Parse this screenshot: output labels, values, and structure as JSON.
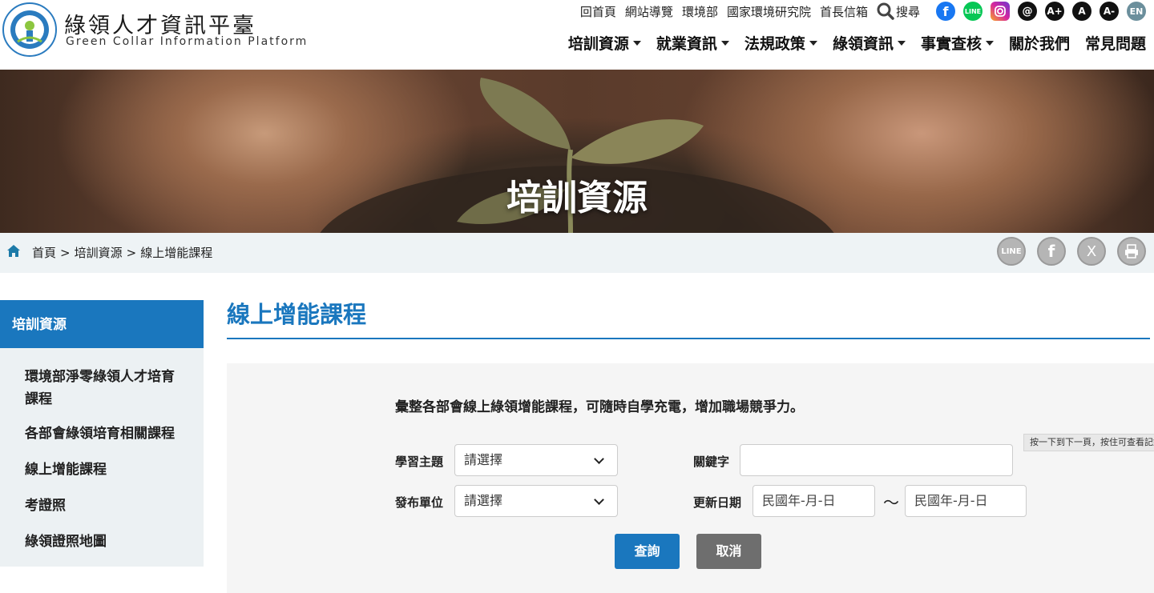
{
  "header": {
    "logo_title": "綠領人才資訊平臺",
    "logo_subtitle": "Green Collar Information Platform",
    "top_links": [
      "回首頁",
      "網站導覽",
      "環境部",
      "國家環境研究院",
      "首長信箱"
    ],
    "search_label": "搜尋",
    "lang_label": "EN",
    "nav": [
      {
        "label": "培訓資源",
        "dropdown": true
      },
      {
        "label": "就業資訊",
        "dropdown": true
      },
      {
        "label": "法規政策",
        "dropdown": true
      },
      {
        "label": "綠領資訊",
        "dropdown": true
      },
      {
        "label": "事實查核",
        "dropdown": true
      },
      {
        "label": "關於我們",
        "dropdown": false
      },
      {
        "label": "常見問題",
        "dropdown": false
      }
    ],
    "social_colors": {
      "facebook": "#1877f2",
      "line": "#06c755",
      "instagram": "#d6249f",
      "threads": "#111111"
    }
  },
  "banner": {
    "title": "培訓資源"
  },
  "breadcrumb": {
    "items": [
      "首頁",
      "培訓資源",
      "線上增能課程"
    ],
    "separator": ">"
  },
  "share": {
    "line_label": "LINE",
    "facebook_label": "f",
    "x_label": "X"
  },
  "sidebar": {
    "heading": "培訓資源",
    "items": [
      {
        "label": "環境部淨零綠領人才培育課程"
      },
      {
        "label": "各部會綠領培育相關課程"
      },
      {
        "label": "線上增能課程"
      },
      {
        "label": "考證照"
      },
      {
        "label": "綠領證照地圖"
      }
    ]
  },
  "main": {
    "title": "線上增能課程",
    "intro": "彙整各部會線上綠領增能課程，可隨時自學充電，增加職場競爭力。",
    "form": {
      "topic_label": "學習主題",
      "topic_value": "請選擇",
      "unit_label": "發布單位",
      "unit_value": "請選擇",
      "keyword_label": "關鍵字",
      "keyword_value": "",
      "date_label": "更新日期",
      "date_from_placeholder": "民國年-月-日",
      "date_to_placeholder": "民國年-月-日",
      "range_sep": "～",
      "submit_label": "查詢",
      "cancel_label": "取消"
    },
    "tooltip": "按一下到下一頁，按住可查看記錄"
  },
  "colors": {
    "primary": "#1a77be",
    "cancel": "#6e6e6e",
    "sidebar_bg": "#ecf1f3",
    "crumb_bg": "#eef3f5"
  }
}
